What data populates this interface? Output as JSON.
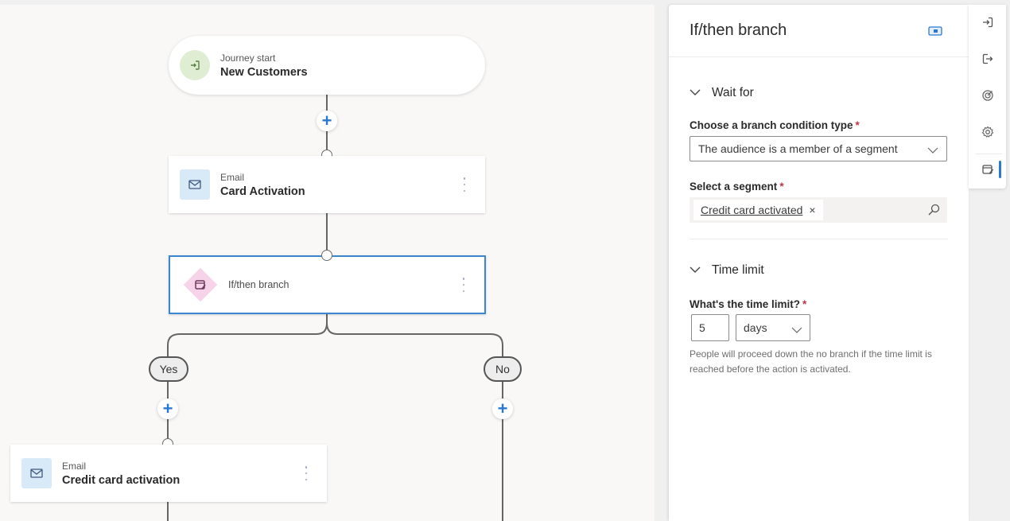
{
  "canvas": {
    "start_node": {
      "subtitle": "Journey start",
      "title": "New Customers",
      "icon": "enter-icon"
    },
    "email_node_1": {
      "type": "Email",
      "title": "Card Activation",
      "icon": "mail-icon"
    },
    "branch_node": {
      "title": "If/then branch",
      "icon": "branch-icon"
    },
    "branch_labels": {
      "yes": "Yes",
      "no": "No"
    },
    "email_node_2": {
      "type": "Email",
      "title": "Credit card activation",
      "icon": "mail-icon"
    },
    "add_button_symbol": "+"
  },
  "panel": {
    "title": "If/then branch",
    "header_icon": "panel-toggle-icon",
    "sections": {
      "wait_for": {
        "title": "Wait for",
        "condition_label": "Choose a branch condition type",
        "condition_value": "The audience is a member of a segment",
        "segment_label": "Select a segment",
        "segment_tag": "Credit card activated",
        "tag_remove": "×",
        "required_mark": "*"
      },
      "time_limit": {
        "title": "Time limit",
        "label": "What's the time limit?",
        "required_mark": "*",
        "value": "5",
        "unit": "days",
        "hint": "People will proceed down the no branch if the time limit is reached before the action is activated."
      }
    }
  },
  "rail": {
    "items": [
      {
        "name": "entry-icon"
      },
      {
        "name": "exit-icon"
      },
      {
        "name": "goal-icon"
      },
      {
        "name": "settings-icon"
      },
      {
        "name": "element-properties-icon",
        "active": true
      }
    ],
    "accent_color": "#2b78d0"
  }
}
